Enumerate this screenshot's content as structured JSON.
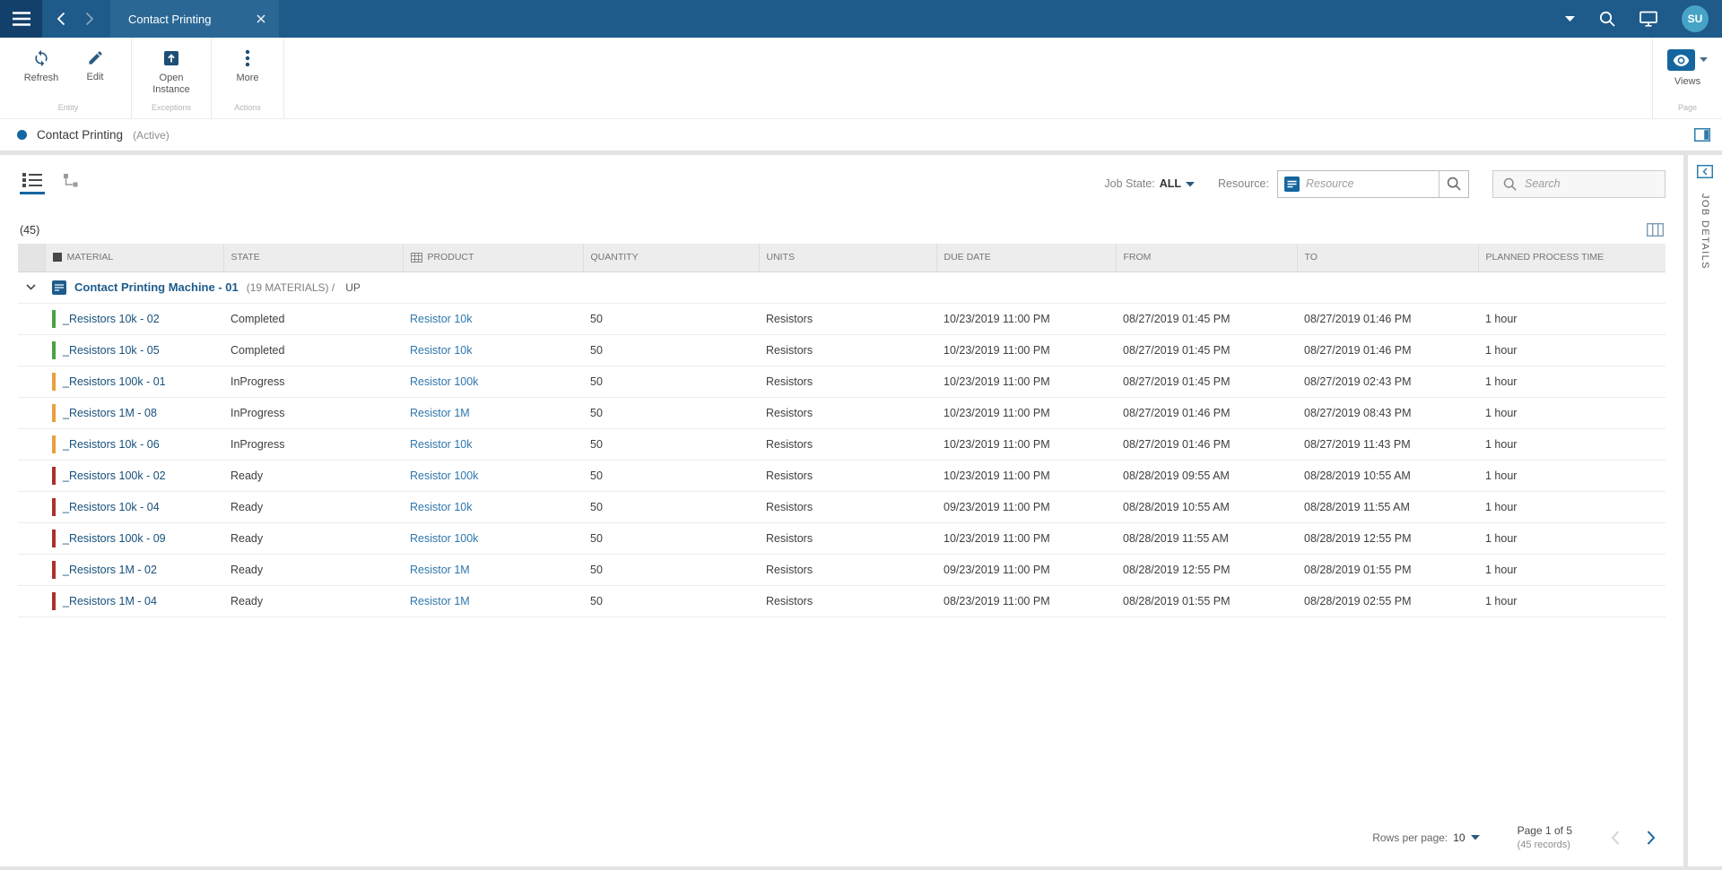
{
  "topbar": {
    "tab_title": "Contact Printing",
    "avatar_initials": "SU"
  },
  "toolbar": {
    "refresh_label": "Refresh",
    "edit_label": "Edit",
    "open_instance_label": "Open Instance",
    "more_label": "More",
    "views_label": "Views",
    "group_entity": "Entity",
    "group_exceptions": "Exceptions",
    "group_actions": "Actions",
    "group_page": "Page"
  },
  "entity_header": {
    "title": "Contact Printing",
    "status": "(Active)"
  },
  "filters": {
    "job_state_label": "Job State:",
    "job_state_value": "ALL",
    "resource_label": "Resource:",
    "resource_placeholder": "Resource",
    "search_placeholder": "Search"
  },
  "records_count": "(45)",
  "table": {
    "columns": [
      "MATERIAL",
      "STATE",
      "PRODUCT",
      "QUANTITY",
      "UNITS",
      "DUE DATE",
      "FROM",
      "TO",
      "PLANNED PROCESS TIME"
    ],
    "group_row": {
      "name": "Contact Printing Machine - 01",
      "materials_count": "(19 MATERIALS) /",
      "state": "UP"
    },
    "rows": [
      {
        "material": "_Resistors 10k - 02",
        "state": "Completed",
        "product": "Resistor 10k",
        "quantity": "50",
        "units": "Resistors",
        "due_date": "10/23/2019 11:00 PM",
        "from": "08/27/2019 01:45 PM",
        "to": "08/27/2019 01:46 PM",
        "planned_time": "1 hour",
        "bar_color": "#4aa147"
      },
      {
        "material": "_Resistors 10k - 05",
        "state": "Completed",
        "product": "Resistor 10k",
        "quantity": "50",
        "units": "Resistors",
        "due_date": "10/23/2019 11:00 PM",
        "from": "08/27/2019 01:45 PM",
        "to": "08/27/2019 01:46 PM",
        "planned_time": "1 hour",
        "bar_color": "#4aa147"
      },
      {
        "material": "_Resistors 100k - 01",
        "state": "InProgress",
        "product": "Resistor 100k",
        "quantity": "50",
        "units": "Resistors",
        "due_date": "10/23/2019 11:00 PM",
        "from": "08/27/2019 01:45 PM",
        "to": "08/27/2019 02:43 PM",
        "planned_time": "1 hour",
        "bar_color": "#e9a13b"
      },
      {
        "material": "_Resistors 1M - 08",
        "state": "InProgress",
        "product": "Resistor 1M",
        "quantity": "50",
        "units": "Resistors",
        "due_date": "10/23/2019 11:00 PM",
        "from": "08/27/2019 01:46 PM",
        "to": "08/27/2019 08:43 PM",
        "planned_time": "1 hour",
        "bar_color": "#e9a13b"
      },
      {
        "material": "_Resistors 10k - 06",
        "state": "InProgress",
        "product": "Resistor 10k",
        "quantity": "50",
        "units": "Resistors",
        "due_date": "10/23/2019 11:00 PM",
        "from": "08/27/2019 01:46 PM",
        "to": "08/27/2019 11:43 PM",
        "planned_time": "1 hour",
        "bar_color": "#e9a13b"
      },
      {
        "material": "_Resistors 100k - 02",
        "state": "Ready",
        "product": "Resistor 100k",
        "quantity": "50",
        "units": "Resistors",
        "due_date": "10/23/2019 11:00 PM",
        "from": "08/28/2019 09:55 AM",
        "to": "08/28/2019 10:55 AM",
        "planned_time": "1 hour",
        "bar_color": "#ac2f2a"
      },
      {
        "material": "_Resistors 10k - 04",
        "state": "Ready",
        "product": "Resistor 10k",
        "quantity": "50",
        "units": "Resistors",
        "due_date": "09/23/2019 11:00 PM",
        "from": "08/28/2019 10:55 AM",
        "to": "08/28/2019 11:55 AM",
        "planned_time": "1 hour",
        "bar_color": "#ac2f2a"
      },
      {
        "material": "_Resistors 100k - 09",
        "state": "Ready",
        "product": "Resistor 100k",
        "quantity": "50",
        "units": "Resistors",
        "due_date": "10/23/2019 11:00 PM",
        "from": "08/28/2019 11:55 AM",
        "to": "08/28/2019 12:55 PM",
        "planned_time": "1 hour",
        "bar_color": "#ac2f2a"
      },
      {
        "material": "_Resistors 1M - 02",
        "state": "Ready",
        "product": "Resistor 1M",
        "quantity": "50",
        "units": "Resistors",
        "due_date": "09/23/2019 11:00 PM",
        "from": "08/28/2019 12:55 PM",
        "to": "08/28/2019 01:55 PM",
        "planned_time": "1 hour",
        "bar_color": "#ac2f2a"
      },
      {
        "material": "_Resistors 1M - 04",
        "state": "Ready",
        "product": "Resistor 1M",
        "quantity": "50",
        "units": "Resistors",
        "due_date": "08/23/2019 11:00 PM",
        "from": "08/28/2019 01:55 PM",
        "to": "08/28/2019 02:55 PM",
        "planned_time": "1 hour",
        "bar_color": "#ac2f2a"
      }
    ]
  },
  "pagination": {
    "rows_per_page_label": "Rows per page:",
    "rows_per_page_value": "10",
    "page_info": "Page 1 of 5",
    "records_info": "(45 records)"
  },
  "side_panel": {
    "title": "JOB DETAILS"
  },
  "colors": {
    "topbar": "#1e5a8a",
    "accent": "#1566a0",
    "state_completed": "#4aa147",
    "state_inprogress": "#e9a13b",
    "state_ready": "#ac2f2a"
  },
  "icons": [
    "menu-icon",
    "back-icon",
    "forward-icon",
    "close-icon",
    "chevron-down-icon",
    "search-icon",
    "monitor-icon",
    "refresh-icon",
    "edit-icon",
    "open-instance-icon",
    "more-icon",
    "views-eye-icon",
    "layout-panel-icon",
    "dock-panel-icon",
    "list-view-icon",
    "tree-view-icon",
    "column-chooser-icon",
    "resource-icon",
    "machine-icon",
    "prev-page-icon",
    "next-page-icon"
  ]
}
